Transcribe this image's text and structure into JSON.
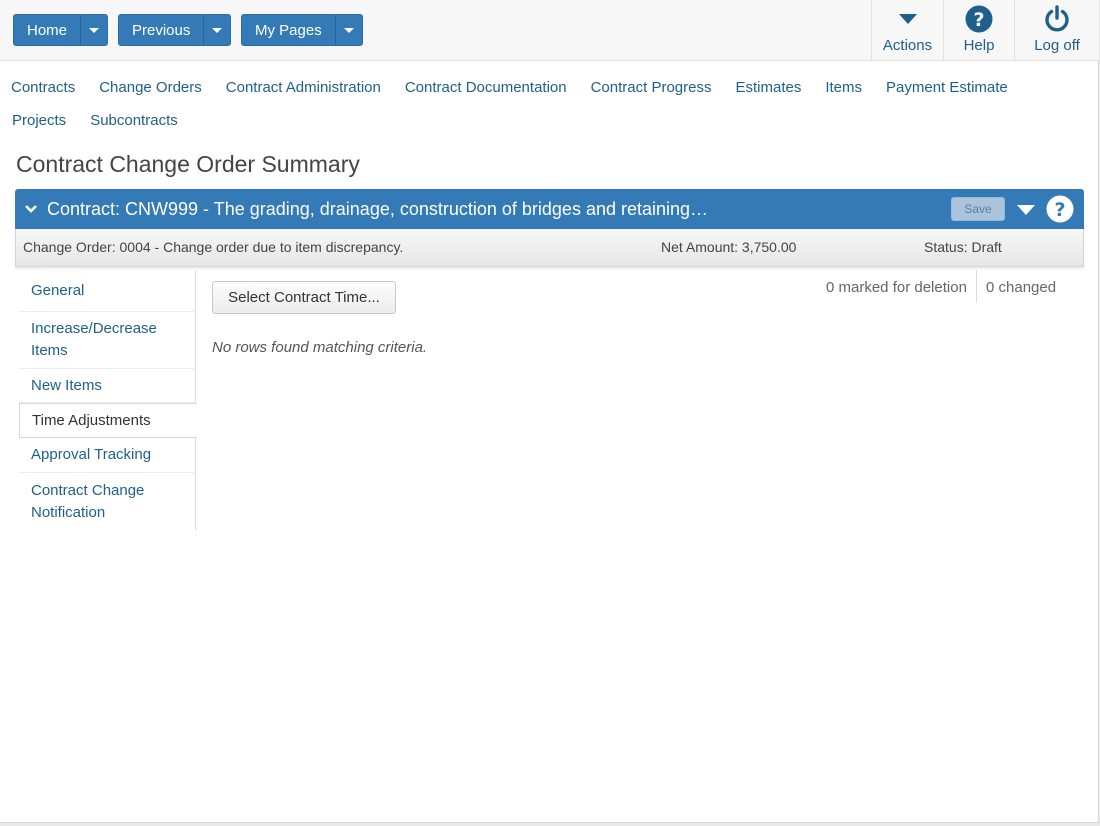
{
  "topbar": {
    "home": "Home",
    "previous": "Previous",
    "my_pages": "My Pages",
    "actions": "Actions",
    "help": "Help",
    "logoff": "Log off"
  },
  "nav": {
    "row1": [
      "Contracts",
      "Change Orders",
      "Contract Administration",
      "Contract Documentation",
      "Contract Progress",
      "Estimates",
      "Items",
      "Payment Estimate"
    ],
    "row2": [
      "Projects",
      "Subcontracts"
    ]
  },
  "page_title": "Contract Change Order Summary",
  "contract": {
    "title": "Contract: CNW999 - The grading, drainage, construction of bridges and retaining…",
    "save_label": "Save"
  },
  "change_order": {
    "label": "Change Order: 0004 - Change order due to item discrepancy.",
    "net_amount": "Net Amount: 3,750.00",
    "status": "Status: Draft"
  },
  "side_tabs": [
    "General",
    "Increase/Decrease Items",
    "New Items",
    "Time Adjustments",
    "Approval Tracking",
    "Contract Change Notification"
  ],
  "active_tab": "Time Adjustments",
  "content": {
    "select_button": "Select Contract Time...",
    "marked_for_deletion": "0 marked for deletion",
    "changed": "0 changed",
    "no_rows": "No rows found matching criteria."
  },
  "colors": {
    "primary": "#337ab7",
    "link": "#1f5f8b"
  }
}
